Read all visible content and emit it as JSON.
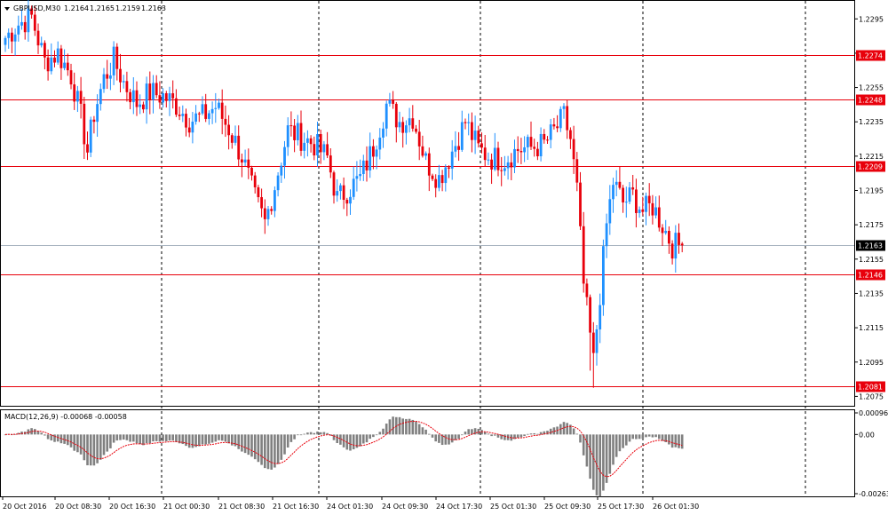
{
  "header": {
    "symbol_label": "GBPUSD,M30",
    "ohlc": [
      "1.2164",
      "1.2165",
      "1.2159",
      "1.2163"
    ]
  },
  "price_axis": {
    "labels": [
      "1.2295",
      "1.2275",
      "1.2255",
      "1.2235",
      "1.2215",
      "1.2195",
      "1.2175",
      "1.2155",
      "1.2135",
      "1.2115",
      "1.2095",
      "1.2075"
    ]
  },
  "levels": [
    {
      "value": 1.2274,
      "label": "1.2274"
    },
    {
      "value": 1.2248,
      "label": "1.2248"
    },
    {
      "value": 1.2209,
      "label": "1.2209"
    },
    {
      "value": 1.2146,
      "label": "1.2146"
    },
    {
      "value": 1.2081,
      "label": "1.2081"
    }
  ],
  "current_price": {
    "value": 1.2163,
    "label": "1.2163"
  },
  "time_axis": {
    "labels": [
      "20 Oct 2016",
      "20 Oct 08:30",
      "20 Oct 16:30",
      "21 Oct 00:30",
      "21 Oct 08:30",
      "21 Oct 16:30",
      "24 Oct 01:30",
      "24 Oct 09:30",
      "24 Oct 17:30",
      "25 Oct 01:30",
      "25 Oct 09:30",
      "25 Oct 17:30",
      "26 Oct 01:30"
    ]
  },
  "macd": {
    "label": "MACD(12,26,9) -0.00068 -0.00058",
    "axis_labels": [
      "0.00096",
      "0.00",
      "-0.00263"
    ]
  },
  "colors": {
    "bull": "#1e90ff",
    "bear": "#e8000b",
    "level": "#e8000b",
    "current": "#a9b4c0",
    "histogram": "#808080",
    "signal": "#e8000b"
  },
  "chart_data": {
    "type": "candlestick",
    "symbol": "GBPUSD",
    "timeframe": "M30",
    "candles_per_separator": 16,
    "price_range": [
      1.2069,
      1.2306
    ],
    "anchors": [
      [
        0,
        1.2284
      ],
      [
        4,
        1.2292
      ],
      [
        8,
        1.2296
      ],
      [
        12,
        1.227
      ],
      [
        16,
        1.2275
      ],
      [
        20,
        1.2262
      ],
      [
        23,
        1.2238
      ],
      [
        25,
        1.2218
      ],
      [
        27,
        1.224
      ],
      [
        30,
        1.226
      ],
      [
        33,
        1.2271
      ],
      [
        36,
        1.2258
      ],
      [
        40,
        1.2246
      ],
      [
        44,
        1.2252
      ],
      [
        48,
        1.225
      ],
      [
        52,
        1.2245
      ],
      [
        56,
        1.2236
      ],
      [
        60,
        1.2238
      ],
      [
        64,
        1.2244
      ],
      [
        68,
        1.2231
      ],
      [
        72,
        1.2215
      ],
      [
        76,
        1.219
      ],
      [
        79,
        1.2176
      ],
      [
        82,
        1.2198
      ],
      [
        86,
        1.223
      ],
      [
        90,
        1.2226
      ],
      [
        94,
        1.2222
      ],
      [
        98,
        1.2214
      ],
      [
        101,
        1.219
      ],
      [
        104,
        1.2195
      ],
      [
        108,
        1.2202
      ],
      [
        112,
        1.222
      ],
      [
        116,
        1.2245
      ],
      [
        120,
        1.2235
      ],
      [
        124,
        1.2238
      ],
      [
        128,
        1.2212
      ],
      [
        132,
        1.2202
      ],
      [
        136,
        1.2218
      ],
      [
        140,
        1.2235
      ],
      [
        144,
        1.2219
      ],
      [
        148,
        1.2214
      ],
      [
        152,
        1.2213
      ],
      [
        156,
        1.2219
      ],
      [
        160,
        1.222
      ],
      [
        164,
        1.2222
      ],
      [
        168,
        1.2232
      ],
      [
        170,
        1.2238
      ],
      [
        172,
        1.2225
      ],
      [
        174,
        1.2195
      ],
      [
        176,
        1.214
      ],
      [
        178,
        1.211
      ],
      [
        179,
        1.2095
      ],
      [
        181,
        1.2135
      ],
      [
        183,
        1.2175
      ],
      [
        185,
        1.22
      ],
      [
        188,
        1.2188
      ],
      [
        191,
        1.2192
      ],
      [
        194,
        1.2183
      ],
      [
        197,
        1.2186
      ],
      [
        200,
        1.2175
      ],
      [
        203,
        1.2163
      ],
      [
        206,
        1.2163
      ]
    ],
    "macd": {
      "params": [
        12,
        26,
        9
      ],
      "main_last": -0.00068,
      "signal_last": -0.00058,
      "range": [
        -0.00263,
        0.00096
      ]
    }
  }
}
